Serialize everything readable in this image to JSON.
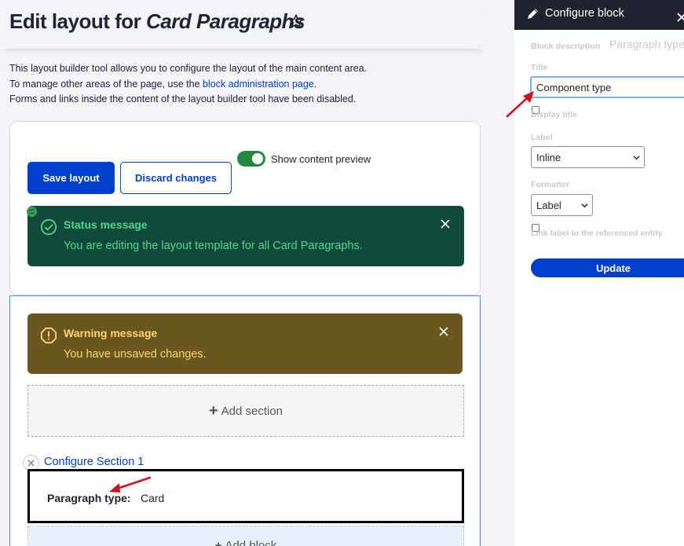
{
  "page": {
    "title_prefix": "Edit layout for ",
    "title_entity": "Card Paragraphs",
    "intro_line1": "This layout builder tool allows you to configure the layout of the main content area.",
    "intro_line2_prefix": "To manage other areas of the page, use the ",
    "intro_line2_link": "block administration page",
    "intro_line2_suffix": ".",
    "intro_line3": "Forms and links inside the content of the layout builder tool have been disabled."
  },
  "actions": {
    "save_label": "Save layout",
    "discard_label": "Discard changes",
    "preview_toggle_label": "Show content preview",
    "preview_enabled": true
  },
  "status_message": {
    "title": "Status message",
    "text": "You are editing the layout template for all Card Paragraphs."
  },
  "warning_message": {
    "title": "Warning message",
    "text": "You have unsaved changes."
  },
  "layout": {
    "add_section_label": "Add section",
    "configure_section_label": "Configure Section 1",
    "block_field_label": "Paragraph type:",
    "block_field_value": "Card",
    "add_block_label": "Add block"
  },
  "dialog": {
    "title": "Configure block",
    "block_description_label": "Block description",
    "block_description_value": "Paragraph type",
    "title_label": "Title",
    "title_value": "Component type",
    "display_title_label": "Display title",
    "label_label": "Label",
    "label_value": "Inline",
    "formatter_label": "Formatter",
    "formatter_value": "Label",
    "link_label": "Link label to the referenced entity",
    "update_label": "Update"
  },
  "colors": {
    "primary": "#003ecc",
    "status_bg": "#0f4a3b",
    "status_text": "#56d48a",
    "warning_bg": "#6b5520",
    "warning_text": "#f8d86a",
    "annotation_arrow": "#d0121b"
  },
  "icons": [
    "star-icon",
    "check-circle-icon",
    "warning-icon",
    "close-icon",
    "plus-icon",
    "pencil-icon",
    "chevron-down-icon",
    "globe-icon"
  ]
}
